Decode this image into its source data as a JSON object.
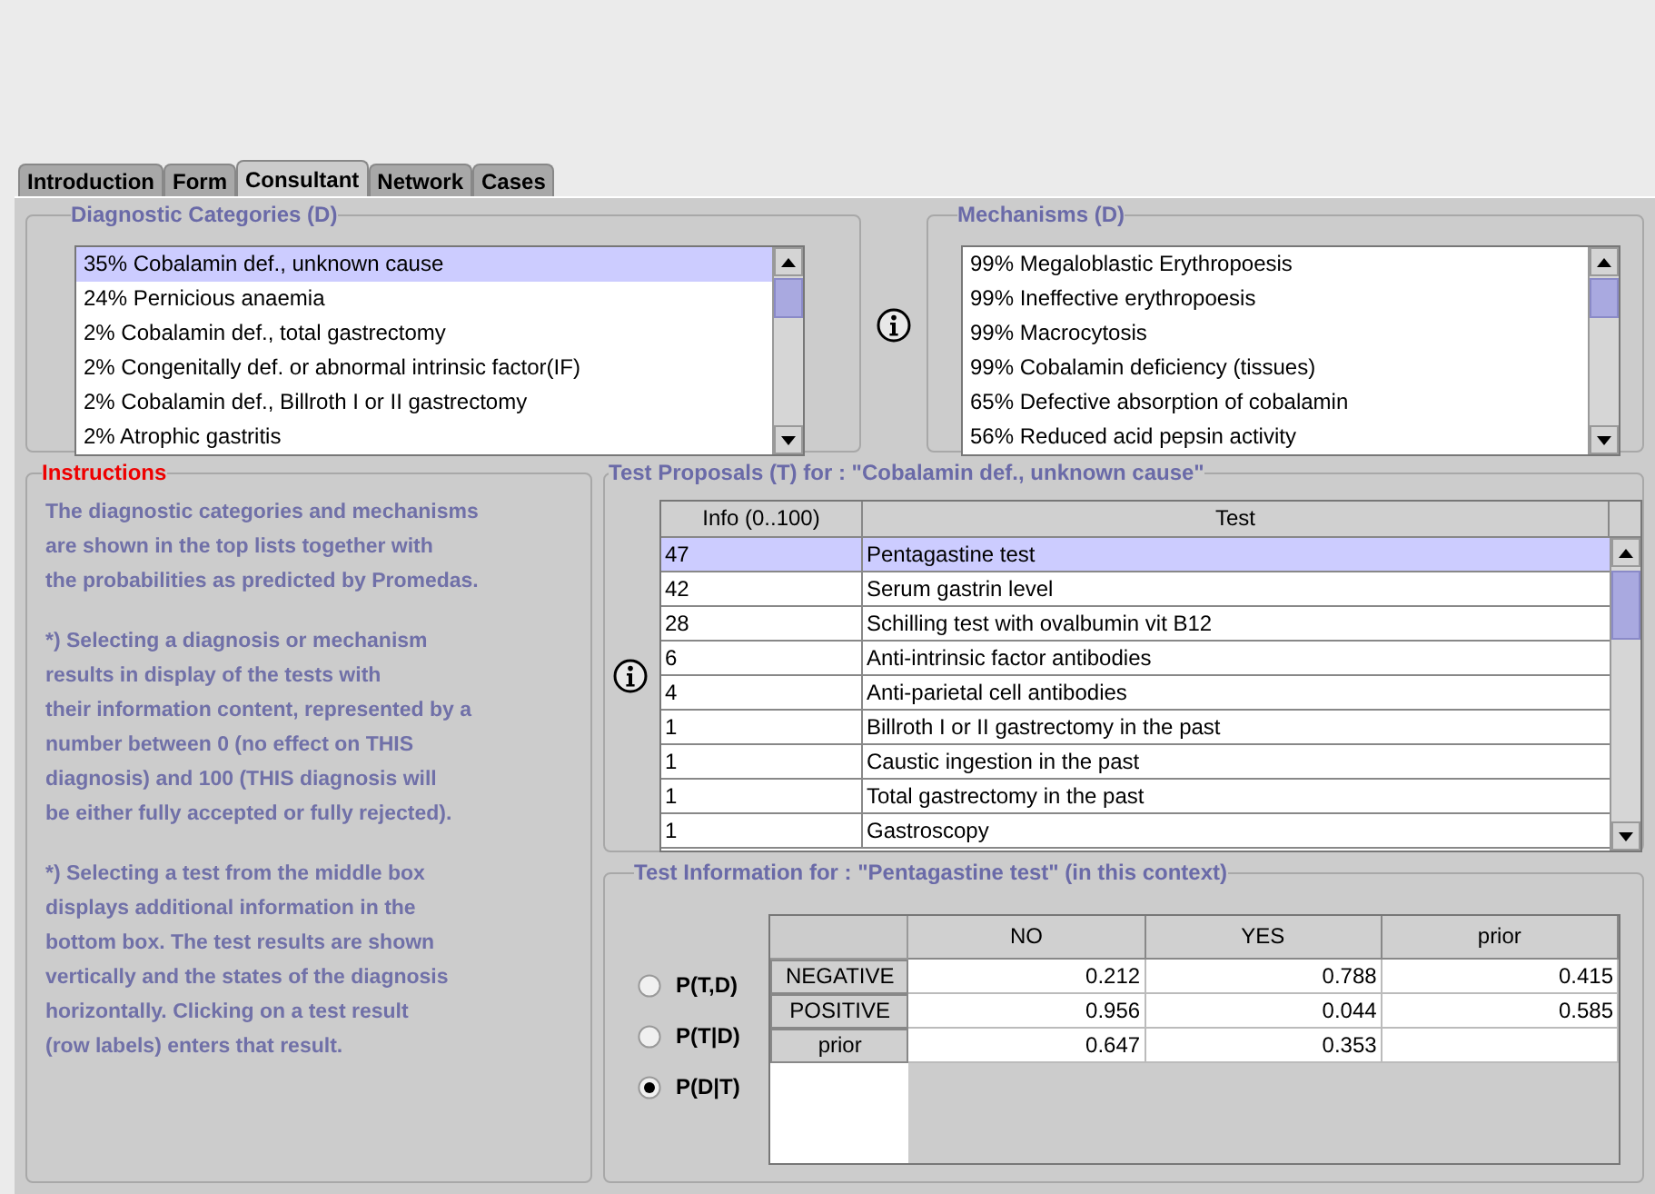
{
  "tabs": [
    {
      "label": "Introduction",
      "selected": false
    },
    {
      "label": "Form",
      "selected": false
    },
    {
      "label": "Consultant",
      "selected": true
    },
    {
      "label": "Network",
      "selected": false
    },
    {
      "label": "Cases",
      "selected": false
    }
  ],
  "diagnostic_categories": {
    "title": "Diagnostic Categories (D)",
    "items": [
      {
        "label": "35% Cobalamin def., unknown cause",
        "selected": true
      },
      {
        "label": "24% Pernicious anaemia",
        "selected": false
      },
      {
        "label": "2% Cobalamin def., total gastrectomy",
        "selected": false
      },
      {
        "label": "2% Congenitally def. or abnormal intrinsic factor(IF)",
        "selected": false
      },
      {
        "label": "2% Cobalamin def., Billroth I or II gastrectomy",
        "selected": false
      },
      {
        "label": "2% Atrophic gastritis",
        "selected": false
      }
    ]
  },
  "mechanisms": {
    "title": "Mechanisms (D)",
    "items": [
      {
        "label": "99% Megaloblastic Erythropoesis",
        "selected": false
      },
      {
        "label": "99% Ineffective erythropoesis",
        "selected": false
      },
      {
        "label": "99% Macrocytosis",
        "selected": false
      },
      {
        "label": "99% Cobalamin deficiency (tissues)",
        "selected": false
      },
      {
        "label": "65% Defective absorption of cobalamin",
        "selected": false
      },
      {
        "label": "56% Reduced acid pepsin activity",
        "selected": false
      }
    ]
  },
  "instructions": {
    "title": "Instructions",
    "paragraphs": [
      [
        "The diagnostic categories and mechanisms",
        "are shown in the top lists together with",
        "the probabilities as predicted by Promedas."
      ],
      [
        "*) Selecting a diagnosis or mechanism",
        "results in display of the tests with",
        "their information content, represented by a",
        "number between 0 (no effect on THIS",
        "diagnosis) and 100 (THIS diagnosis will",
        "be either fully accepted or fully rejected)."
      ],
      [
        "*) Selecting a test from the middle box",
        "displays additional information in the",
        "bottom box. The test results are shown",
        "vertically and the states of the diagnosis",
        "horizontally. Clicking on a test result",
        "(row labels) enters that result."
      ]
    ]
  },
  "test_proposals": {
    "title": "Test Proposals (T) for : \"Cobalamin def., unknown cause\"",
    "columns": [
      "Info (0..100)",
      "Test"
    ],
    "rows": [
      {
        "info": "47",
        "test": "Pentagastine test",
        "selected": true
      },
      {
        "info": "42",
        "test": "Serum gastrin level",
        "selected": false
      },
      {
        "info": "28",
        "test": "Schilling test with ovalbumin vit B12",
        "selected": false
      },
      {
        "info": "6",
        "test": "Anti-intrinsic factor antibodies",
        "selected": false
      },
      {
        "info": "4",
        "test": "Anti-parietal cell antibodies",
        "selected": false
      },
      {
        "info": "1",
        "test": "Billroth I or II gastrectomy in the past",
        "selected": false
      },
      {
        "info": "1",
        "test": "Caustic ingestion in the past",
        "selected": false
      },
      {
        "info": "1",
        "test": "Total gastrectomy in the past",
        "selected": false
      },
      {
        "info": "1",
        "test": "Gastroscopy",
        "selected": false
      }
    ]
  },
  "test_information": {
    "title": "Test Information for : \"Pentagastine test\" (in this context)",
    "modes": [
      {
        "label": "P(T,D)",
        "selected": false
      },
      {
        "label": "P(T|D)",
        "selected": false
      },
      {
        "label": "P(D|T)",
        "selected": true
      }
    ],
    "columns": [
      "NO",
      "YES",
      "prior"
    ],
    "rows": [
      {
        "label": "NEGATIVE",
        "values": [
          "0.212",
          "0.788",
          "0.415"
        ]
      },
      {
        "label": "POSITIVE",
        "values": [
          "0.956",
          "0.044",
          "0.585"
        ]
      },
      {
        "label": "prior",
        "values": [
          "0.647",
          "0.353"
        ]
      }
    ]
  }
}
